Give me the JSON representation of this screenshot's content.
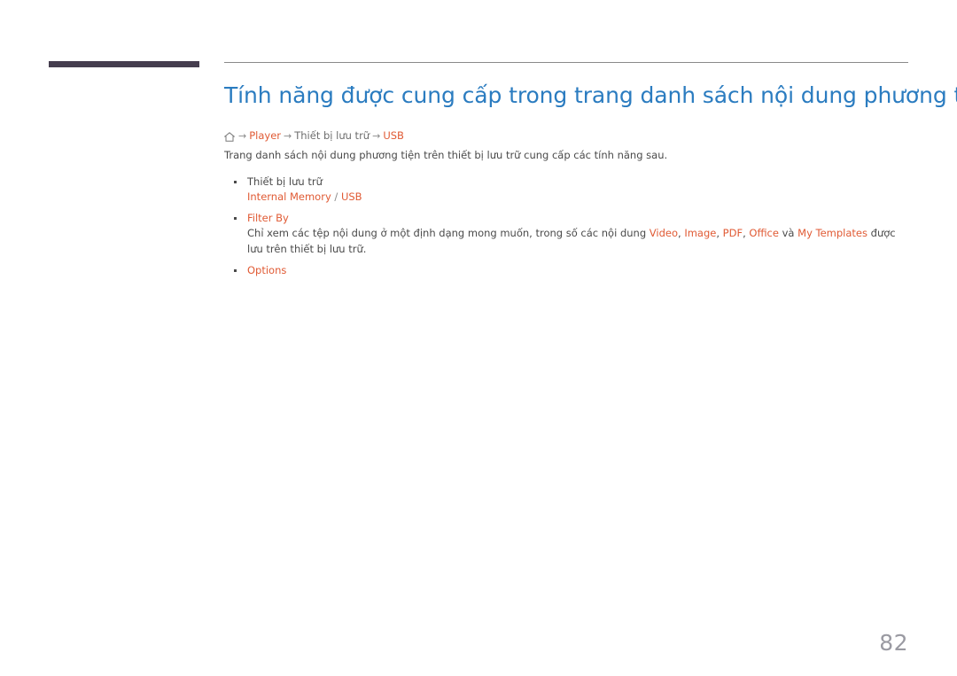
{
  "decor": {
    "tab_bar_color": "#453d4e",
    "rule_color": "#8a8a8a",
    "title_color": "#2b7cc0",
    "accent_color": "#e05a34",
    "body_color": "#4a4a4a",
    "muted_color": "#8a8a8a"
  },
  "header": {
    "title": "Tính năng được cung cấp trong trang danh sách nội dung phương tiện"
  },
  "breadcrumb": {
    "home_icon": "home-icon",
    "arrow": "→",
    "items": [
      {
        "label": "Player",
        "accent": true
      },
      {
        "label": "Thiết bị lưu trữ",
        "accent": false
      },
      {
        "label": "USB",
        "accent": true
      }
    ]
  },
  "intro": {
    "text": "Trang danh sách nội dung phương tiện trên thiết bị lưu trữ cung cấp các tính năng sau."
  },
  "features": [
    {
      "term": "Thiết bị lưu trữ",
      "term_accent": false,
      "sub_parts": [
        {
          "text": "Internal Memory",
          "accent": true
        },
        {
          "text": " / ",
          "accent": false
        },
        {
          "text": "USB",
          "accent": true
        }
      ]
    },
    {
      "term": "Filter By",
      "term_accent": true,
      "sub_parts": [
        {
          "text": "Chỉ xem các tệp nội dung ở một định dạng mong muốn, trong số các nội dung ",
          "accent": false
        },
        {
          "text": "Video",
          "accent": true
        },
        {
          "text": ", ",
          "accent": false
        },
        {
          "text": "Image",
          "accent": true
        },
        {
          "text": ", ",
          "accent": false
        },
        {
          "text": "PDF",
          "accent": true
        },
        {
          "text": ", ",
          "accent": false
        },
        {
          "text": "Office",
          "accent": true
        },
        {
          "text": " và ",
          "accent": false
        },
        {
          "text": "My Templates",
          "accent": true
        },
        {
          "text": " được lưu trên thiết bị lưu trữ.",
          "accent": false
        }
      ]
    },
    {
      "term": "Options",
      "term_accent": true,
      "sub_parts": []
    }
  ],
  "footer": {
    "page_number": "82"
  }
}
